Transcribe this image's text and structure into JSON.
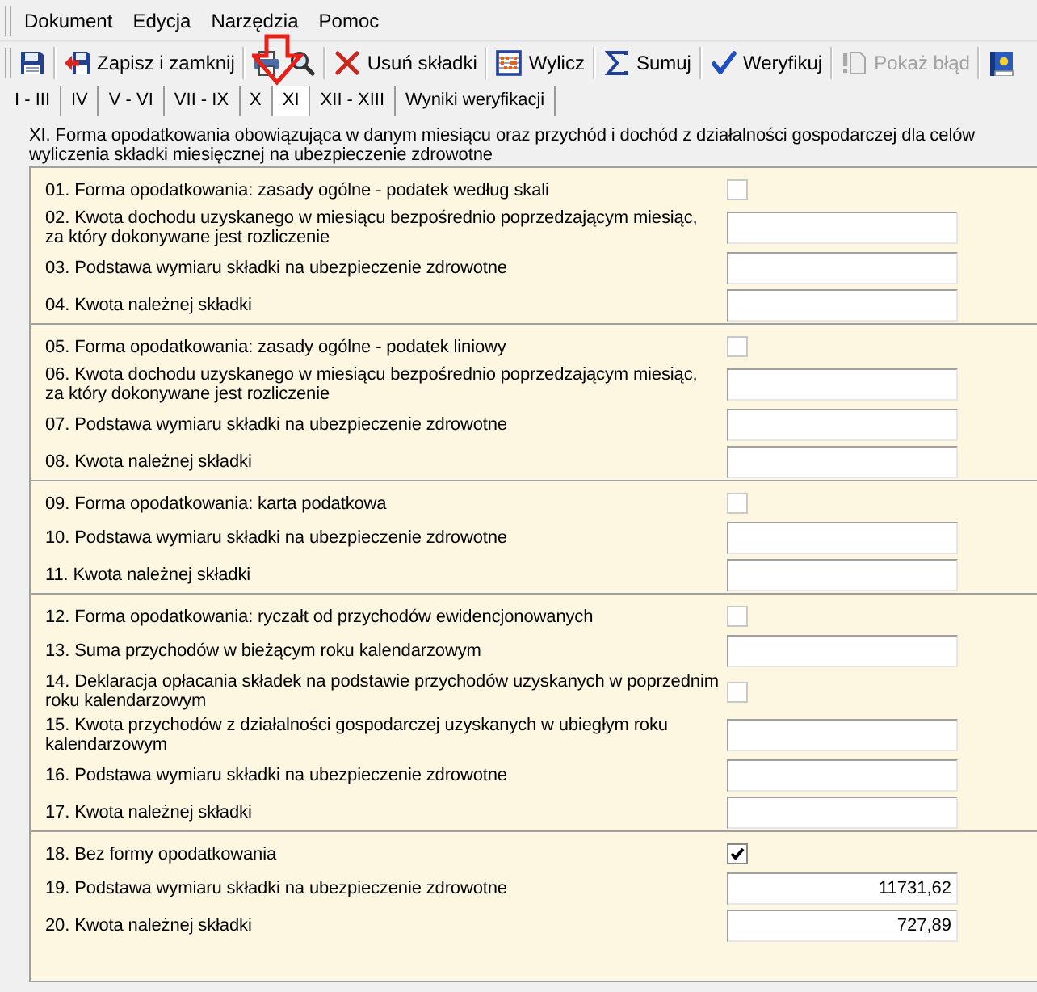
{
  "menu_bar": {
    "items": [
      "Dokument",
      "Edycja",
      "Narzędzia",
      "Pomoc"
    ]
  },
  "toolbar": {
    "groups": [
      [
        {
          "kind": "icon",
          "disabled": false
        }
      ],
      [
        {
          "kind": "labeled",
          "label": "Zapisz i zamknij",
          "disabled": false
        }
      ],
      [
        {
          "kind": "icon",
          "disabled": false
        },
        {
          "kind": "icon",
          "disabled": false
        }
      ],
      [
        {
          "kind": "labeled",
          "label": "Usuń składki",
          "disabled": false
        }
      ],
      [
        {
          "kind": "labeled",
          "label": "Wylicz",
          "disabled": false
        }
      ],
      [
        {
          "kind": "labeled",
          "label": "Sumuj",
          "disabled": false
        }
      ],
      [
        {
          "kind": "labeled",
          "label": "Weryfikuj",
          "disabled": false
        }
      ],
      [
        {
          "kind": "labeled",
          "label": "Pokaż błąd",
          "disabled": true
        }
      ],
      [
        {
          "kind": "icon",
          "disabled": false
        }
      ]
    ]
  },
  "tabs": [
    {
      "label": "I - III",
      "selected": false
    },
    {
      "label": "IV",
      "selected": false
    },
    {
      "label": "V - VI",
      "selected": false
    },
    {
      "label": "VII - IX",
      "selected": false
    },
    {
      "label": "X",
      "selected": false
    },
    {
      "label": "XI",
      "selected": true
    },
    {
      "label": "XII - XIII",
      "selected": false
    },
    {
      "label": "Wyniki weryfikacji",
      "selected": false
    }
  ],
  "section": {
    "title": "XI. Forma opodatkowania obowiązująca w danym miesiącu oraz przychód i dochód z działalności gospodarczej dla celów\nwyliczenia składki miesięcznej na ubezpieczenie zdrowotne",
    "groups": [
      {
        "rows": [
          {
            "kind": "checkbox",
            "label": "01. Forma opodatkowania: zasady ogólne - podatek według skali",
            "checked": false
          },
          {
            "kind": "input",
            "label": "02. Kwota dochodu uzyskanego w miesiącu bezpośrednio poprzedzającym miesiąc,\nza który dokonywane jest rozliczenie"
          },
          {
            "kind": "input",
            "label": "03. Podstawa wymiaru składki na ubezpieczenie zdrowotne"
          },
          {
            "kind": "input",
            "label": "04. Kwota należnej składki"
          }
        ]
      },
      {
        "rows": [
          {
            "kind": "checkbox",
            "label": "05. Forma opodatkowania: zasady ogólne - podatek liniowy",
            "checked": false
          },
          {
            "kind": "input",
            "label": "06. Kwota dochodu uzyskanego w miesiącu bezpośrednio poprzedzającym miesiąc,\nza który dokonywane jest rozliczenie"
          },
          {
            "kind": "input",
            "label": "07. Podstawa wymiaru składki na ubezpieczenie zdrowotne"
          },
          {
            "kind": "input",
            "label": "08. Kwota należnej składki"
          }
        ]
      },
      {
        "rows": [
          {
            "kind": "checkbox",
            "label": "09. Forma opodatkowania: karta podatkowa",
            "checked": false
          },
          {
            "kind": "input",
            "label": "10. Podstawa wymiaru składki na ubezpieczenie zdrowotne"
          },
          {
            "kind": "input",
            "label": "11. Kwota należnej składki"
          }
        ]
      },
      {
        "rows": [
          {
            "kind": "checkbox",
            "label": "12. Forma opodatkowania: ryczałt od przychodów ewidencjonowanych",
            "checked": false
          },
          {
            "kind": "input",
            "label": "13. Suma przychodów w bieżącym roku kalendarzowym"
          },
          {
            "kind": "checkbox",
            "label": "14. Deklaracja opłacania składek na podstawie przychodów uzyskanych w poprzednim\nroku kalendarzowym",
            "checked": false
          },
          {
            "kind": "input",
            "label": "15. Kwota przychodów z działalności gospodarczej uzyskanych w ubiegłym roku\nkalendarzowym"
          },
          {
            "kind": "input",
            "label": "16. Podstawa wymiaru składki na ubezpieczenie zdrowotne"
          },
          {
            "kind": "input",
            "label": "17. Kwota należnej składki"
          }
        ]
      },
      {
        "rows": [
          {
            "kind": "checkbox",
            "label": "18. Bez formy opodatkowania",
            "checked": true
          },
          {
            "kind": "input",
            "label": "19. Podstawa wymiaru składki na ubezpieczenie zdrowotne",
            "value": "11731,62"
          },
          {
            "kind": "input",
            "label": "20. Kwota należnej składki",
            "value": "727,89"
          }
        ]
      }
    ]
  }
}
